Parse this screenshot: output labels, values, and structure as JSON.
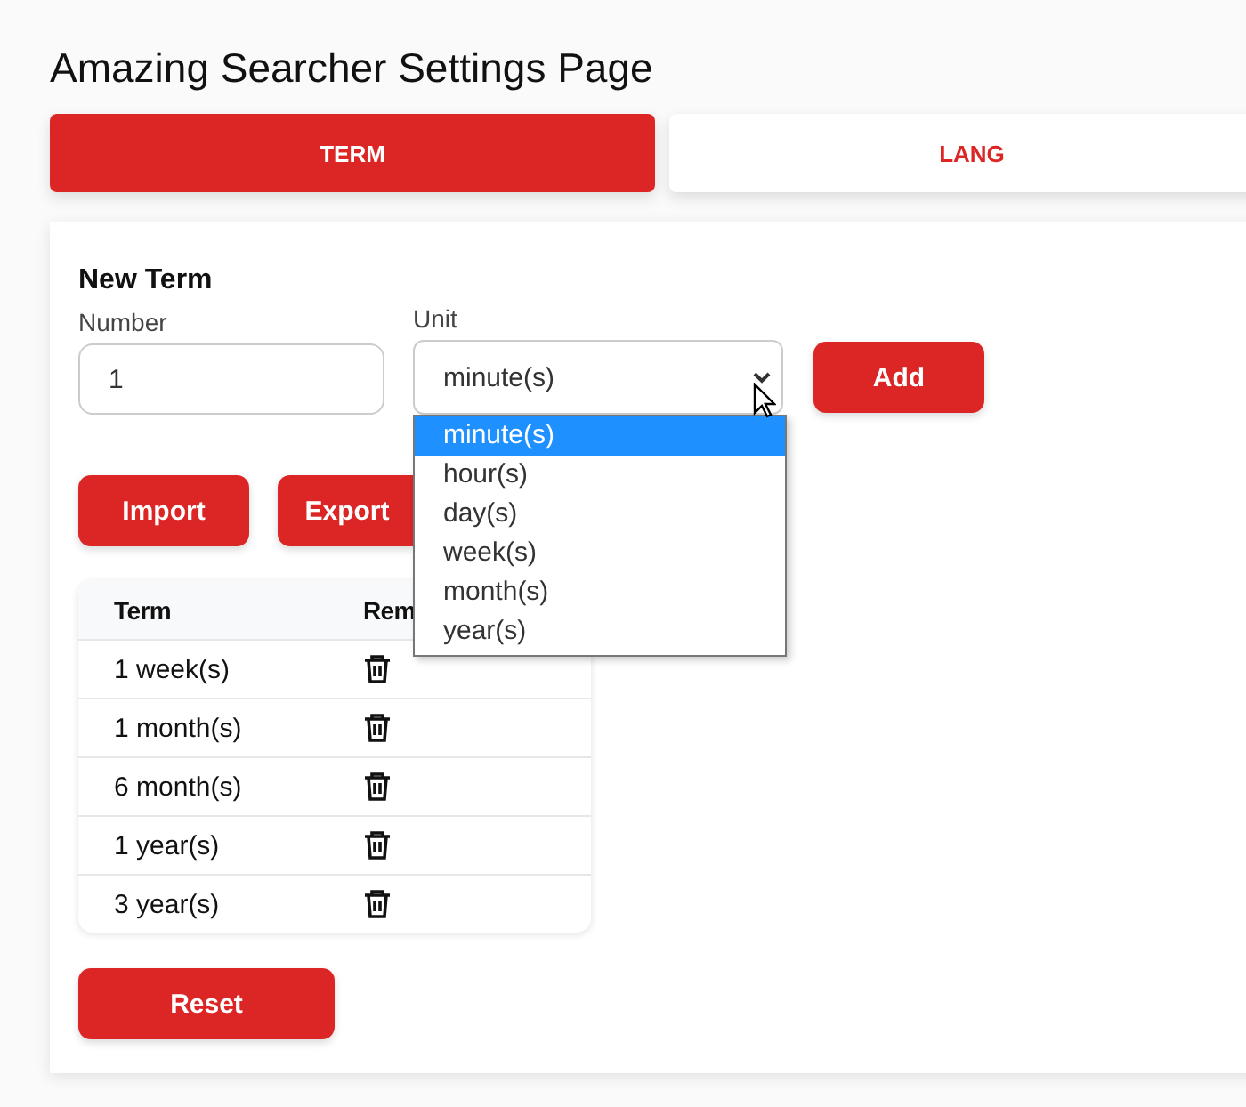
{
  "page": {
    "title": "Amazing Searcher Settings Page"
  },
  "tabs": [
    {
      "label": "TERM",
      "selected": true
    },
    {
      "label": "LANG",
      "selected": false
    }
  ],
  "new_term": {
    "heading": "New Term",
    "number": {
      "label": "Number",
      "value": "1"
    },
    "unit": {
      "label": "Unit",
      "value": "minute(s)",
      "expanded": true,
      "options": [
        {
          "label": "minute(s)",
          "selected": true
        },
        {
          "label": "hour(s)",
          "selected": false
        },
        {
          "label": "day(s)",
          "selected": false
        },
        {
          "label": "week(s)",
          "selected": false
        },
        {
          "label": "month(s)",
          "selected": false
        },
        {
          "label": "year(s)",
          "selected": false
        }
      ]
    },
    "add_button": "Add"
  },
  "actions": [
    "Import",
    "Export"
  ],
  "table": {
    "columns": [
      "Term",
      "Rem"
    ],
    "rows": [
      {
        "term": "1 week(s)"
      },
      {
        "term": "1 month(s)"
      },
      {
        "term": "6 month(s)"
      },
      {
        "term": "1 year(s)"
      },
      {
        "term": "3 year(s)"
      }
    ]
  },
  "reset_button": "Reset"
}
